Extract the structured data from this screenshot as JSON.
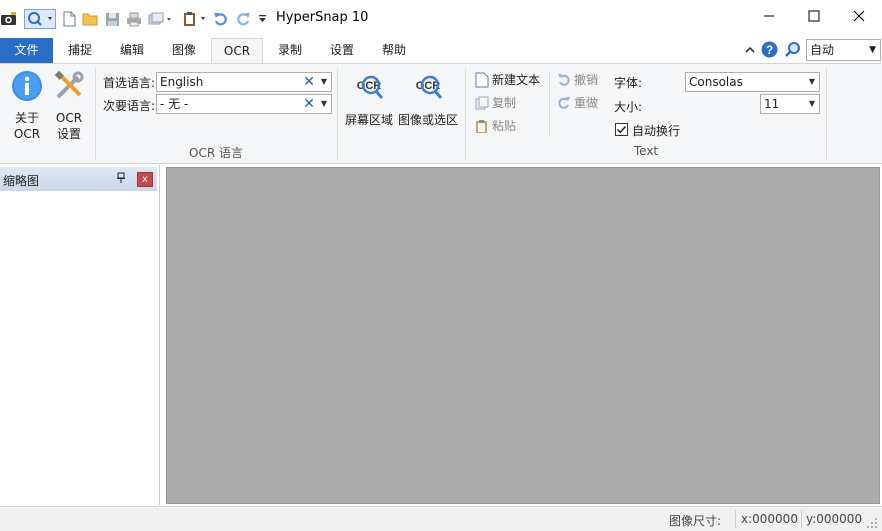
{
  "app": {
    "title": "HyperSnap 10"
  },
  "window_controls": {
    "minimize": "—",
    "maximize": "☐",
    "close": "✕"
  },
  "tabs": [
    {
      "label": "文件"
    },
    {
      "label": "捕捉"
    },
    {
      "label": "编辑"
    },
    {
      "label": "图像"
    },
    {
      "label": "OCR"
    },
    {
      "label": "录制"
    },
    {
      "label": "设置"
    },
    {
      "label": "帮助"
    }
  ],
  "active_tab": "OCR",
  "zoom": {
    "value": "自动"
  },
  "ribbon": {
    "about_ocr": {
      "line1": "关于",
      "line2": "OCR"
    },
    "ocr_settings": {
      "line1": "OCR",
      "line2": "设置"
    },
    "ocr_language": {
      "primary_label": "首选语言:",
      "primary_value": "English",
      "secondary_label": "次要语言:",
      "secondary_value": "- 无 -",
      "group_label": "OCR 语言"
    },
    "screen_region": {
      "label": "屏幕区域",
      "icon_text": "OCR"
    },
    "image_selection": {
      "label": "图像或选区",
      "icon_text": "OCR"
    },
    "text_group": {
      "new_text": "新建文本",
      "copy": "复制",
      "paste": "粘贴",
      "undo": "撤销",
      "redo": "重做",
      "font_label": "字体:",
      "font_value": "Consolas",
      "size_label": "大小:",
      "size_value": "11",
      "wrap_label": "自动换行",
      "wrap_checked": true,
      "group_label": "Text"
    }
  },
  "thumbnail_pane": {
    "title": "缩略图",
    "pin": "ᵖ",
    "close": "x"
  },
  "status_bar": {
    "image_size_label": "图像尺寸:",
    "x": "x:000000",
    "y": "y:000000"
  },
  "colors": {
    "accent": "#2b6cc4",
    "canvas": "#ababab",
    "ribbon": "#f5f6f7"
  }
}
